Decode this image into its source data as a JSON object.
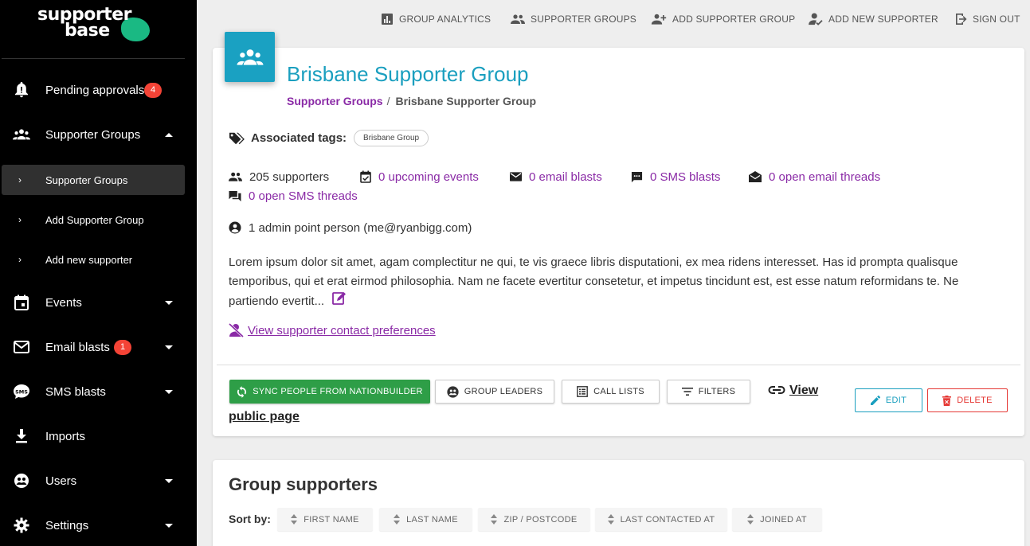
{
  "brand": {
    "line1": "supporter",
    "line2": "base"
  },
  "sidebar": {
    "items": [
      {
        "label": "Pending approvals",
        "badge": "4"
      },
      {
        "label": "Supporter Groups"
      },
      {
        "label": "Events"
      },
      {
        "label": "Email blasts",
        "badge": "1"
      },
      {
        "label": "SMS blasts"
      },
      {
        "label": "Imports"
      },
      {
        "label": "Users"
      },
      {
        "label": "Settings"
      }
    ],
    "subitems": [
      {
        "label": "Supporter Groups"
      },
      {
        "label": "Add Supporter Group"
      },
      {
        "label": "Add new supporter"
      }
    ]
  },
  "topnav": {
    "analytics": "GROUP ANALYTICS",
    "groups": "SUPPORTER GROUPS",
    "add_group": "ADD SUPPORTER GROUP",
    "add_supporter": "ADD NEW SUPPORTER",
    "sign_out": "SIGN OUT"
  },
  "group": {
    "title": "Brisbane Supporter Group",
    "breadcrumb_parent": "Supporter Groups",
    "breadcrumb_sep": "/",
    "breadcrumb_current": "Brisbane Supporter Group",
    "tags_label": "Associated tags:",
    "tag": "Brisbane Group",
    "stats": {
      "supporters": "205 supporters",
      "events": "0 upcoming events",
      "email_blasts": "0 email blasts",
      "sms_blasts": "0 SMS blasts",
      "email_threads": "0 open email threads",
      "sms_threads": "0 open SMS threads"
    },
    "admin": "1 admin point person (me@ryanbigg.com)",
    "description": "Lorem ipsum dolor sit amet, agam complectitur ne qui, te vis graece libris disputationi, ex mea ridens interesset. Has id prompta qualisque temporibus, qui et erat eirmod philosophia. Nam ne facete evertitur consetetur, et impetus tincidunt est, est esse natum reformidans te. Ne partiendo evertit...",
    "preferences_link": "View supporter contact preferences"
  },
  "actions": {
    "sync": "SYNC PEOPLE FROM NATIONBUILDER",
    "leaders": "GROUP LEADERS",
    "call_lists": "CALL LISTS",
    "filters": "FILTERS",
    "view_public_1": "View",
    "view_public_2": "public page",
    "edit": "EDIT",
    "delete": "DELETE"
  },
  "supporters_section": {
    "title": "Group supporters",
    "sort_label": "Sort by:",
    "sort_options": [
      "FIRST NAME",
      "LAST NAME",
      "ZIP / POSTCODE",
      "LAST CONTACTED AT",
      "JOINED AT"
    ]
  },
  "colors": {
    "accent": "#1aa1c2",
    "link": "#8a2aa6",
    "green": "#2e9e47",
    "danger": "#e53935",
    "sidebar_bg": "#000000"
  }
}
